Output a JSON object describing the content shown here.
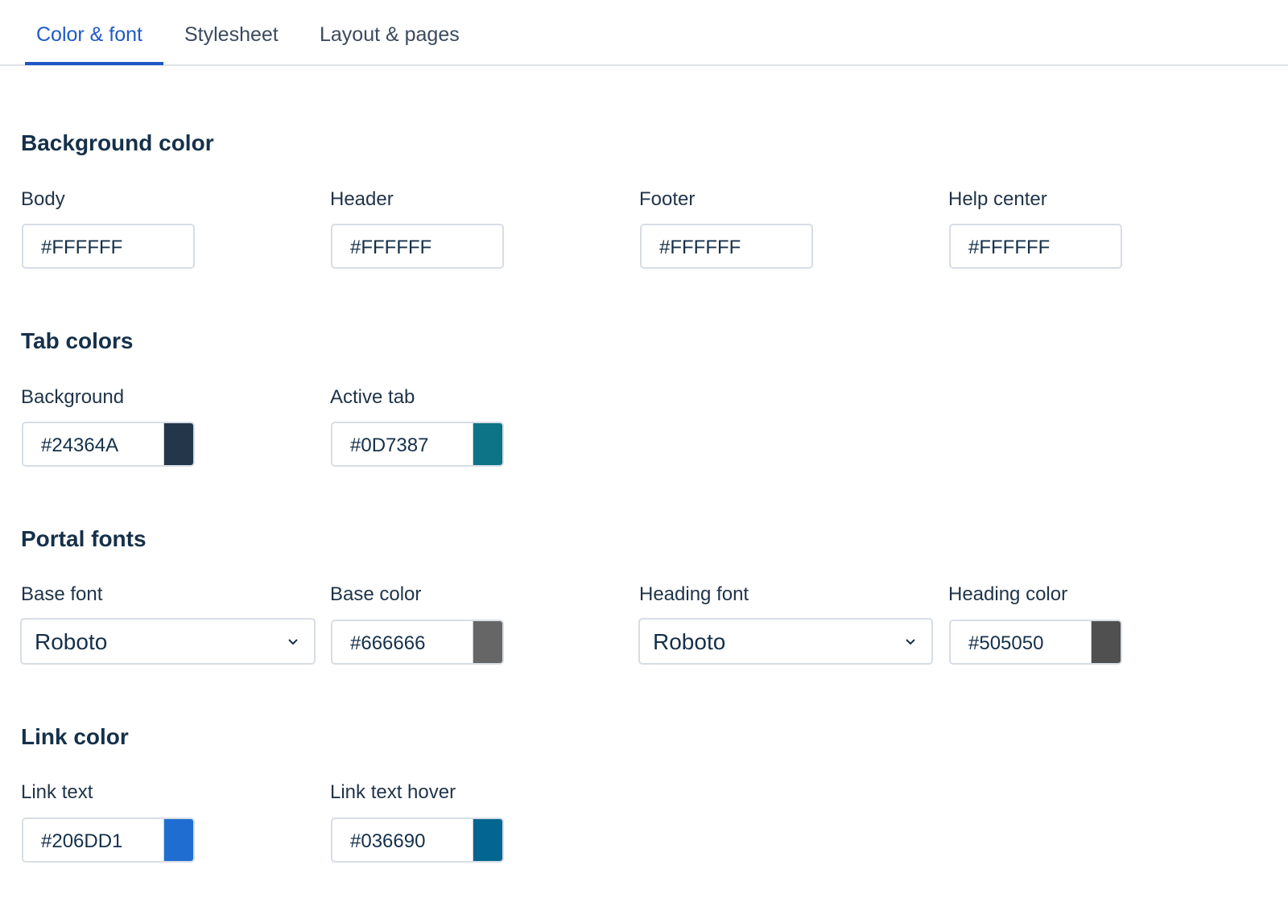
{
  "tabs": [
    {
      "label": "Color & font",
      "active": true
    },
    {
      "label": "Stylesheet",
      "active": false
    },
    {
      "label": "Layout & pages",
      "active": false
    }
  ],
  "sections": {
    "background_color": {
      "title": "Background color",
      "fields": [
        {
          "label": "Body",
          "value": "#FFFFFF"
        },
        {
          "label": "Header",
          "value": "#FFFFFF"
        },
        {
          "label": "Footer",
          "value": "#FFFFFF"
        },
        {
          "label": "Help center",
          "value": "#FFFFFF"
        }
      ]
    },
    "tab_colors": {
      "title": "Tab colors",
      "fields": [
        {
          "label": "Background",
          "value": "#24364A",
          "swatch": "#24364A"
        },
        {
          "label": "Active tab",
          "value": "#0D7387",
          "swatch": "#0D7387"
        }
      ]
    },
    "portal_fonts": {
      "title": "Portal fonts",
      "base_font": {
        "label": "Base font",
        "value": "Roboto"
      },
      "base_color": {
        "label": "Base color",
        "value": "#666666",
        "swatch": "#666666"
      },
      "heading_font": {
        "label": "Heading font",
        "value": "Roboto"
      },
      "heading_color": {
        "label": "Heading color",
        "value": "#505050",
        "swatch": "#505050"
      }
    },
    "link_color": {
      "title": "Link color",
      "fields": [
        {
          "label": "Link text",
          "value": "#206DD1",
          "swatch": "#206DD1"
        },
        {
          "label": "Link text hover",
          "value": "#036690",
          "swatch": "#036690"
        }
      ]
    }
  },
  "colors": {
    "accent": "#1E56C6",
    "border": "#D7DDE5"
  }
}
